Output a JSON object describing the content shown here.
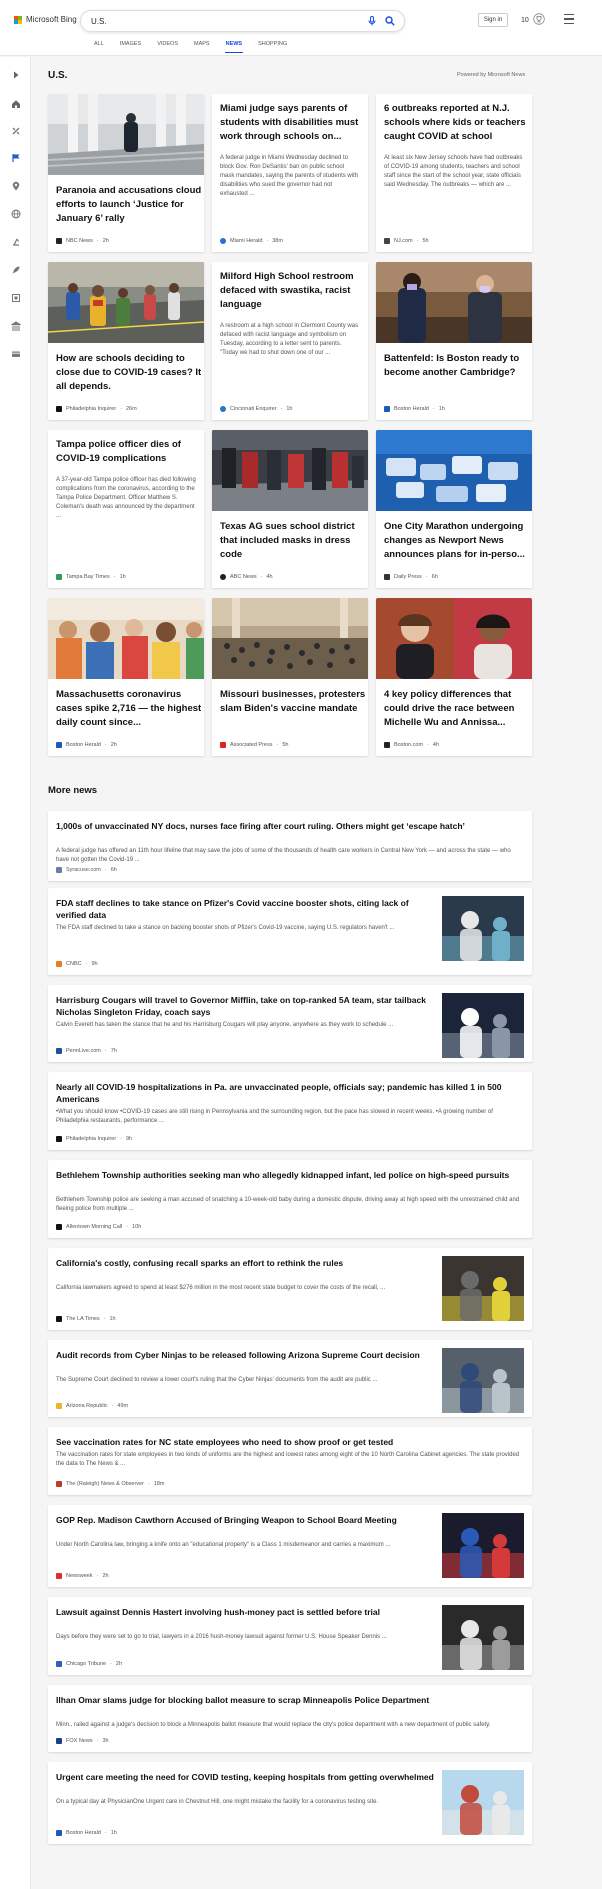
{
  "header": {
    "brand": "Microsoft Bing",
    "query": "U.S.",
    "signin_label": "Sign in",
    "rewards_count": "10",
    "tabs": [
      {
        "label": "ALL"
      },
      {
        "label": "IMAGES"
      },
      {
        "label": "VIDEOS"
      },
      {
        "label": "MAPS"
      },
      {
        "label": "NEWS"
      },
      {
        "label": "SHOPPING"
      }
    ],
    "active_tab": "NEWS"
  },
  "rail_icons": [
    "expand-icon",
    "home-icon",
    "tools-icon",
    "flag-icon",
    "location-icon",
    "globe-icon",
    "science-icon",
    "rocket-icon",
    "film-icon",
    "bank-icon",
    "card-icon"
  ],
  "main": {
    "section_title": "U.S.",
    "powered_by": "Powered by Microsoft News",
    "cards": [
      {
        "title": "Paranoia and accusations cloud efforts to launch ‘Justice for January 6’ rally",
        "snippet": "",
        "source": "NBC News",
        "time": "2h",
        "favicon_color": "#222222"
      },
      {
        "title": "Miami judge says parents of students with disabilities must work through schools on...",
        "snippet": "A federal judge in Miami Wednesday declined to block Gov. Ron DeSantis' ban on public school mask mandates, saying the parents of students with disabilities who sued the governor had not exhausted ...",
        "source": "Miami Herald",
        "time": "38m",
        "favicon_color": "#2b6cd9"
      },
      {
        "title": "6 outbreaks reported at N.J. schools where kids or teachers caught COVID at school",
        "snippet": "At least six New Jersey schools have had outbreaks of COVID-19 among students, teachers and school staff since the start of the school year, state officials said Wednesday. The outbreaks — which are ...",
        "source": "NJ.com",
        "time": "5h",
        "favicon_color": "#444444"
      },
      {
        "title": "How are schools deciding to close due to COVID-19 cases? It all depends.",
        "snippet": "",
        "source": "Philadelphia Inquirer",
        "time": "26m",
        "favicon_color": "#111111"
      },
      {
        "title": "Milford High School restroom defaced with swastika, racist language",
        "snippet": "A restroom at a high school in Clermont County was defaced with racist language and symbolism on Tuesday, according to a letter sent to parents. \"Today we had to shut down one of our ...",
        "source": "Cincinnati Enquirer",
        "time": "1h",
        "favicon_color": "#2d74c9"
      },
      {
        "title": "Battenfeld: Is Boston ready to become another Cambridge?",
        "snippet": "",
        "source": "Boston Herald",
        "time": "1h",
        "favicon_color": "#1e5bb8"
      },
      {
        "title": "Tampa police officer dies of COVID-19 complications",
        "snippet": "A 37-year-old Tampa police officer has died following complications from the coronavirus, according to the Tampa Police Department. Officer Matthew S. Coleman's death was announced by the department ...",
        "source": "Tampa Bay Times",
        "time": "1h",
        "favicon_color": "#2ca05a"
      },
      {
        "title": "Texas AG sues school district that included masks in dress code",
        "snippet": "",
        "source": "ABC News",
        "time": "4h",
        "favicon_color": "#222222"
      },
      {
        "title": "One City Marathon undergoing changes as Newport News announces plans for in-perso...",
        "snippet": "",
        "source": "Daily Press",
        "time": "6h",
        "favicon_color": "#333333"
      },
      {
        "title": "Massachusetts coronavirus cases spike 2,716 — the highest daily count since...",
        "snippet": "",
        "source": "Boston Herald",
        "time": "2h",
        "favicon_color": "#1e5bb8"
      },
      {
        "title": "Missouri businesses, protesters slam Biden's vaccine mandate",
        "snippet": "",
        "source": "Associated Press",
        "time": "5h",
        "favicon_color": "#d9251d"
      },
      {
        "title": "4 key policy differences that could drive the race between Michelle Wu and Annissa...",
        "snippet": "",
        "source": "Boston.com",
        "time": "4h",
        "favicon_color": "#222222"
      }
    ]
  },
  "more_news": {
    "title": "More news",
    "items": [
      {
        "title": "1,000s of unvaccinated NY docs, nurses face firing after court ruling. Others might get ‘escape hatch’",
        "snippet": "A federal judge has offered an 11th hour lifeline that may save the jobs of some of the thousands of health care workers in Central New York — and across the state — who have not gotten the Covid-19 ...",
        "source": "Syracuse.com",
        "time": "6h",
        "favicon_color": "#6a7fa8",
        "has_image": false
      },
      {
        "title": "FDA staff declines to take stance on Pfizer's Covid vaccine booster shots, citing lack of verified data",
        "snippet": "The FDA staff declined to take a stance on backing booster shots of Pfizer's Covid-19 vaccine, saying U.S. regulators haven't ...",
        "source": "CNBC",
        "time": "9h",
        "favicon_color": "#e67e22",
        "has_image": true
      },
      {
        "title": "Harrisburg Cougars will travel to Governor Mifflin, take on top-ranked 5A team, star tailback Nicholas Singleton Friday, coach says",
        "snippet": "Calvin Everett has taken the stance that he and his Harrisburg Cougars will play anyone, anywhere as they work to schedule ...",
        "source": "PennLive.com",
        "time": "7h",
        "favicon_color": "#1f4fa0",
        "has_image": true
      },
      {
        "title": "Nearly all COVID-19 hospitalizations in Pa. are unvaccinated people, officials say; pandemic has killed 1 in 500 Americans",
        "snippet": "•What you should know •COVID-19 cases are still rising in Pennsylvania and the surrounding region, but the pace has slowed in recent weeks. •A growing number of Philadelphia restaurants, performance ...",
        "source": "Philadelphia Inquirer",
        "time": "9h",
        "favicon_color": "#111111",
        "has_image": false
      },
      {
        "title": "Bethlehem Township authorities seeking man who allegedly kidnapped infant, led police on high-speed pursuits",
        "snippet": "Bethlehem Township police are seeking a man accused of snatching a 10-week-old baby during a domestic dispute, driving away at high speed with the unrestrained child and fleeing police from multiple ...",
        "source": "Allentown Morning Call",
        "time": "10h",
        "favicon_color": "#111111",
        "has_image": false
      },
      {
        "title": "California's costly, confusing recall sparks an effort to rethink the rules",
        "snippet": "California lawmakers agreed to spend at least $276 million in the most recent state budget to cover the costs of the recall, ...",
        "source": "The LA Times",
        "time": "1h",
        "favicon_color": "#111111",
        "has_image": true
      },
      {
        "title": "Audit records from Cyber Ninjas to be released following Arizona Supreme Court decision",
        "snippet": "The Supreme Court declined to review a lower court's ruling that the Cyber Ninjas' documents from the audit are public ...",
        "source": "Arizona Republic",
        "time": "49m",
        "favicon_color": "#f0b429",
        "has_image": true
      },
      {
        "title": "See vaccination rates for NC state employees who need to show proof or get tested",
        "snippet": "The vaccination rates for state employees in two kinds of uniforms are the highest and lowest rates among eight of the 10 North Carolina Cabinet agencies. The state provided the data to The News & ...",
        "source": "The (Raleigh) News & Observer",
        "time": "18m",
        "favicon_color": "#c0392b",
        "has_image": false
      },
      {
        "title": "GOP Rep. Madison Cawthorn Accused of Bringing Weapon to School Board Meeting",
        "snippet": "Under North Carolina law, bringing a knife onto an \"educational property\" is a Class 1 misdemeanor and carries a maximum ...",
        "source": "Newsweek",
        "time": "2h",
        "favicon_color": "#e32b2b",
        "has_image": true
      },
      {
        "title": "Lawsuit against Dennis Hastert involving hush-money pact is settled before trial",
        "snippet": "Days before they were set to go to trial, lawyers in a 2016 hush-money lawsuit against former U.S. House Speaker Dennis ...",
        "source": "Chicago Tribune",
        "time": "2h",
        "favicon_color": "#2f5faf",
        "has_image": true
      },
      {
        "title": "Ilhan Omar slams judge for blocking ballot measure to scrap Minneapolis Police Department",
        "snippet": "Minn., railed against a judge's decision to block a Minneapolis ballot measure that would replace the city's police department with a new department of public safety.",
        "source": "FOX News",
        "time": "3h",
        "favicon_color": "#1c3f8a",
        "has_image": false
      },
      {
        "title": "Urgent care meeting the need for COVID testing, keeping hospitals from getting overwhelmed",
        "snippet": "On a typical day at PhysicianOne Urgent care in Chestnut Hill, one might mistake the facility for a coronavirus testing site.",
        "source": "Boston Herald",
        "time": "1h",
        "favicon_color": "#1e5bb8",
        "has_image": true
      }
    ]
  },
  "colors": {
    "accent": "#174ae4",
    "card_bg": "#ffffff",
    "page_bg": "#f5f5f5"
  }
}
